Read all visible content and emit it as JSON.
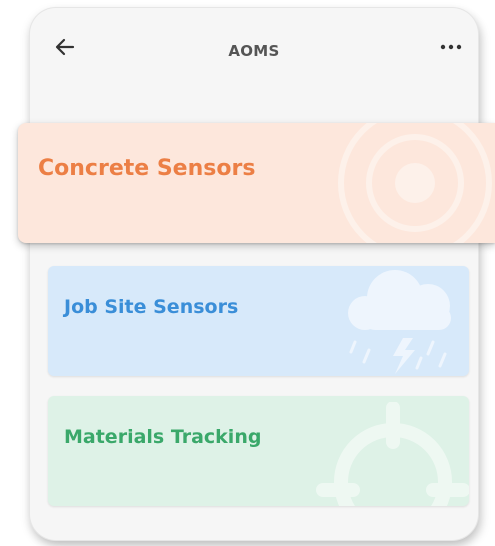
{
  "app": {
    "title": "AOMS"
  },
  "icons": {
    "back": "arrow-left-icon",
    "more": "more-horizontal-icon"
  },
  "cards": [
    {
      "label": "Concrete Sensors",
      "icon": "target-rings-icon",
      "bg": "#fde7dc",
      "fg": "#ec7f45"
    },
    {
      "label": "Job Site Sensors",
      "icon": "storm-cloud-icon",
      "bg": "#d7e9fa",
      "fg": "#3a8ed8"
    },
    {
      "label": "Materials Tracking",
      "icon": "crosshair-icon",
      "bg": "#def2e7",
      "fg": "#3aa86a"
    }
  ]
}
